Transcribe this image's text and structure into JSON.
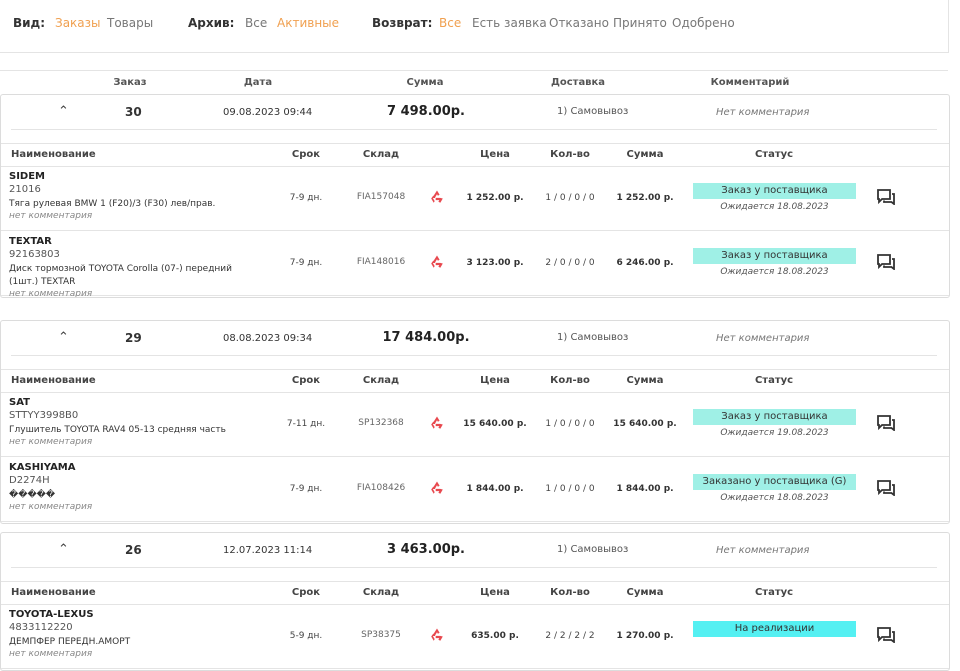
{
  "filters": {
    "view_label": "Вид:",
    "view_options": [
      "Заказы",
      "Товары"
    ],
    "archive_label": "Архив:",
    "archive_options": [
      "Все",
      "Активные"
    ],
    "return_label": "Возврат:",
    "return_options": [
      "Все",
      "Есть заявка",
      "Отказано",
      "Принято",
      "Одобрено"
    ],
    "active_color": "#f0a050"
  },
  "columns": {
    "order": "Заказ",
    "date": "Дата",
    "sum": "Сумма",
    "delivery": "Доставка",
    "comment": "Комментарий"
  },
  "item_columns": {
    "name": "Наименование",
    "term": "Срок",
    "stock": "Склад",
    "price": "Цена",
    "qty": "Кол-во",
    "sum": "Сумма",
    "status": "Статус"
  },
  "orders": [
    {
      "number": "30",
      "date": "09.08.2023 09:44",
      "sum": "7 498.00р.",
      "delivery": "1) Самовывоз",
      "comment": "Нет комментария",
      "items": [
        {
          "brand": "SIDEM",
          "article": "21016",
          "name": "Тяга рулевая BMW 1 (F20)/3 (F30) лев/прав.",
          "comment": "нет комментария",
          "term": "7-9 дн.",
          "stock": "FIA157048",
          "price": "1 252.00 р.",
          "qty": "1 / 0 / 0 / 0",
          "sum": "1 252.00 р.",
          "status": "Заказ у поставщика",
          "expected": "Ожидается 18.08.2023"
        },
        {
          "brand": "TEXTAR",
          "article": "92163803",
          "name": "Диск тормозной TOYOTA Corolla (07-) передний (1шт.) TEXTAR",
          "comment": "нет комментария",
          "term": "7-9 дн.",
          "stock": "FIA148016",
          "price": "3 123.00 р.",
          "qty": "2 / 0 / 0 / 0",
          "sum": "6 246.00 р.",
          "status": "Заказ у поставщика",
          "expected": "Ожидается 18.08.2023"
        }
      ]
    },
    {
      "number": "29",
      "date": "08.08.2023 09:34",
      "sum": "17 484.00р.",
      "delivery": "1) Самовывоз",
      "comment": "Нет комментария",
      "items": [
        {
          "brand": "SAT",
          "article": "STTYY3998B0",
          "name": "Глушитель TOYOTA RAV4 05-13 средняя часть",
          "comment": "нет комментария",
          "term": "7-11 дн.",
          "stock": "SP132368",
          "price": "15 640.00 р.",
          "qty": "1 / 0 / 0 / 0",
          "sum": "15 640.00 р.",
          "status": "Заказ у поставщика",
          "expected": "Ожидается 19.08.2023"
        },
        {
          "brand": "KASHIYAMA",
          "article": "D2274H",
          "name": "�����",
          "comment": "нет комментария",
          "term": "7-9 дн.",
          "stock": "FIA108426",
          "price": "1 844.00 р.",
          "qty": "1 / 0 / 0 / 0",
          "sum": "1 844.00 р.",
          "status": "Заказано у поставщика (G)",
          "expected": "Ожидается 18.08.2023"
        }
      ]
    },
    {
      "number": "26",
      "date": "12.07.2023 11:14",
      "sum": "3 463.00р.",
      "delivery": "1) Самовывоз",
      "comment": "Нет комментария",
      "items": [
        {
          "brand": "TOYOTA-LEXUS",
          "article": "4833112220",
          "name": "ДЕМПФЕР ПЕРЕДН.АМОРТ",
          "comment": "нет комментария",
          "term": "5-9 дн.",
          "stock": "SP38375",
          "price": "635.00 р.",
          "qty": "2 / 2 / 2 / 2",
          "sum": "1 270.00 р.",
          "status": "На реализации",
          "expected": ""
        }
      ]
    }
  ],
  "icons": {
    "collapse": "chevron-up-icon",
    "return": "recycle-icon",
    "message": "chat-icon"
  },
  "status_colors": {
    "supplier": "#9ff0e6",
    "realization": "#54f0f2"
  }
}
